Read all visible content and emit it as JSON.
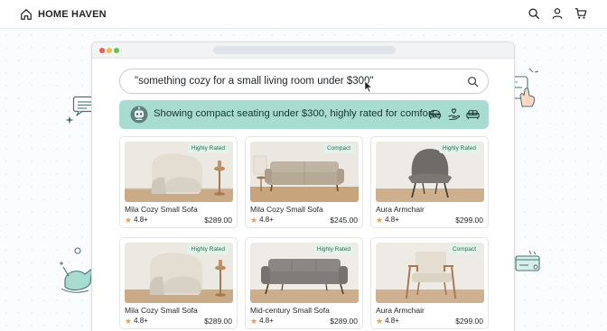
{
  "header": {
    "brand": "HOME HAVEN",
    "icons": [
      "home-icon",
      "search-icon",
      "user-icon",
      "cart-icon"
    ]
  },
  "search": {
    "query": "\"something cozy for a small living room under $300\""
  },
  "summary": {
    "text": "Showing compact seating under $300, highly rated for comfort.",
    "icons": [
      "armchair-icon",
      "hand-heart-icon",
      "sofa-icon"
    ]
  },
  "products": [
    {
      "name": "Mila Cozy Small Sofa",
      "rating": "4.8+",
      "price": "$289.00",
      "badge": "Highly Rated",
      "image": "boucle-chair"
    },
    {
      "name": "Mila Cozy Small Sofa",
      "rating": "4.8+",
      "price": "$245.00",
      "badge": "Compact",
      "image": "loveseat"
    },
    {
      "name": "Aura Armchair",
      "rating": "4.8+",
      "price": "$299.00",
      "badge": "Highly Rated",
      "image": "grey-chair"
    },
    {
      "name": "Mila Cozy Small Sofa",
      "rating": "4.8+",
      "price": "$289.00",
      "badge": "Highly Rated",
      "image": "boucle-chair"
    },
    {
      "name": "Mid-century Small Sofa",
      "rating": "4.8+",
      "price": "$289.00",
      "badge": "Highly Rated",
      "image": "grey-sofa"
    },
    {
      "name": "Aura Armchair",
      "rating": "4.8+",
      "price": "$299.00",
      "badge": "Compact",
      "image": "wood-armchair"
    }
  ],
  "colors": {
    "accent": "#a8dcd1",
    "badge_bg": "#e2f3ea",
    "star": "#e9a23b"
  }
}
